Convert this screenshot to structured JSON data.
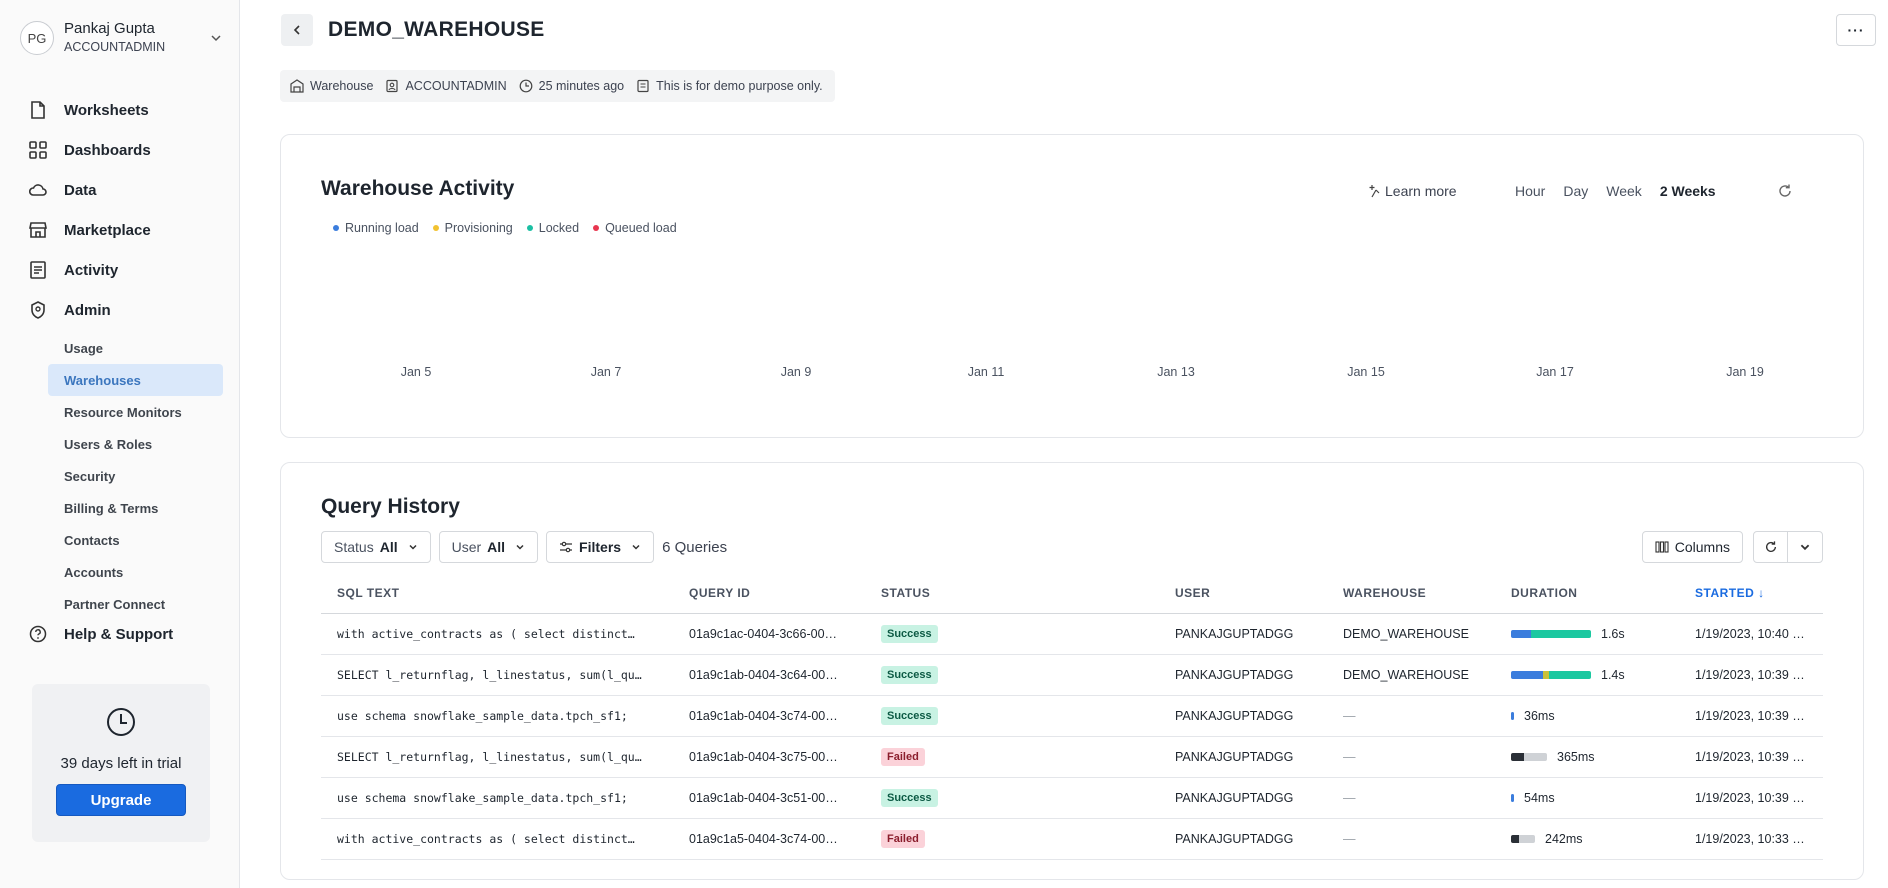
{
  "user": {
    "initials": "PG",
    "name": "Pankaj Gupta",
    "role": "ACCOUNTADMIN"
  },
  "nav": {
    "items": [
      {
        "label": "Worksheets",
        "icon": "document-icon"
      },
      {
        "label": "Dashboards",
        "icon": "grid-icon"
      },
      {
        "label": "Data",
        "icon": "cloud-icon"
      },
      {
        "label": "Marketplace",
        "icon": "store-icon"
      },
      {
        "label": "Activity",
        "icon": "list-icon"
      },
      {
        "label": "Admin",
        "icon": "shield-icon"
      }
    ],
    "admin_sub": [
      "Usage",
      "Warehouses",
      "Resource Monitors",
      "Users & Roles",
      "Security",
      "Billing & Terms",
      "Contacts",
      "Accounts",
      "Partner Connect"
    ],
    "help": "Help & Support"
  },
  "trial": {
    "text": "39 days left in trial",
    "button": "Upgrade"
  },
  "page": {
    "title": "DEMO_WAREHOUSE",
    "meta": {
      "type": "Warehouse",
      "owner": "ACCOUNTADMIN",
      "time": "25 minutes ago",
      "comment": "This is for demo purpose only."
    }
  },
  "activity": {
    "title": "Warehouse Activity",
    "learn_more": "Learn more",
    "ranges": [
      "Hour",
      "Day",
      "Week",
      "2 Weeks"
    ],
    "active_range": "2 Weeks",
    "legend": [
      {
        "label": "Running load",
        "color": "#3b7ddd"
      },
      {
        "label": "Provisioning",
        "color": "#f2c230"
      },
      {
        "label": "Locked",
        "color": "#1bbfa3"
      },
      {
        "label": "Queued load",
        "color": "#e8364f"
      }
    ],
    "ticks": [
      "Jan 5",
      "Jan 7",
      "Jan 9",
      "Jan 11",
      "Jan 13",
      "Jan 15",
      "Jan 17",
      "Jan 19"
    ]
  },
  "history": {
    "title": "Query History",
    "status_filter": {
      "label": "Status",
      "value": "All"
    },
    "user_filter": {
      "label": "User",
      "value": "All"
    },
    "filters_label": "Filters",
    "count": "6 Queries",
    "columns_label": "Columns",
    "headers": [
      "SQL TEXT",
      "QUERY ID",
      "STATUS",
      "USER",
      "WAREHOUSE",
      "DURATION",
      "STARTED"
    ],
    "rows": [
      {
        "sql": "with active_contracts as ( select distinct…",
        "qid": "01a9c1ac-0404-3c66-00…",
        "status": "Success",
        "user": "PANKAJGUPTADGG",
        "warehouse": "DEMO_WAREHOUSE",
        "duration": "1.6s",
        "duration_parts": [
          {
            "frac": 0.25,
            "color": "#3b7ddd"
          },
          {
            "frac": 0.75,
            "color": "#1bc8a0"
          }
        ],
        "started": "1/19/2023, 10:40 …"
      },
      {
        "sql": "SELECT l_returnflag, l_linestatus, sum(l_qu…",
        "qid": "01a9c1ab-0404-3c64-00…",
        "status": "Success",
        "user": "PANKAJGUPTADGG",
        "warehouse": "DEMO_WAREHOUSE",
        "duration": "1.4s",
        "duration_parts": [
          {
            "frac": 0.4,
            "color": "#3b7ddd"
          },
          {
            "frac": 0.07,
            "color": "#c9c13a"
          },
          {
            "frac": 0.53,
            "color": "#1bc8a0"
          }
        ],
        "started": "1/19/2023, 10:39 …"
      },
      {
        "sql": "use schema snowflake_sample_data.tpch_sf1;",
        "qid": "01a9c1ab-0404-3c74-00…",
        "status": "Success",
        "user": "PANKAJGUPTADGG",
        "warehouse": "—",
        "duration": "36ms",
        "duration_parts": [
          {
            "frac": 1.0,
            "color": "#3b7ddd"
          }
        ],
        "started": "1/19/2023, 10:39 …"
      },
      {
        "sql": "SELECT l_returnflag, l_linestatus, sum(l_qu…",
        "qid": "01a9c1ab-0404-3c75-00…",
        "status": "Failed",
        "user": "PANKAJGUPTADGG",
        "warehouse": "—",
        "duration": "365ms",
        "duration_parts": [
          {
            "frac": 0.35,
            "color": "#2a2f36"
          },
          {
            "frac": 0.65,
            "color": "#cfd2d6"
          }
        ],
        "started": "1/19/2023, 10:39 …"
      },
      {
        "sql": "use schema snowflake_sample_data.tpch_sf1;",
        "qid": "01a9c1ab-0404-3c51-00…",
        "status": "Success",
        "user": "PANKAJGUPTADGG",
        "warehouse": "—",
        "duration": "54ms",
        "duration_parts": [
          {
            "frac": 1.0,
            "color": "#3b7ddd"
          }
        ],
        "started": "1/19/2023, 10:39 …"
      },
      {
        "sql": "with active_contracts as ( select distinct…",
        "qid": "01a9c1a5-0404-3c74-00…",
        "status": "Failed",
        "user": "PANKAJGUPTADGG",
        "warehouse": "—",
        "duration": "242ms",
        "duration_parts": [
          {
            "frac": 0.35,
            "color": "#2a2f36"
          },
          {
            "frac": 0.65,
            "color": "#cfd2d6"
          }
        ],
        "started": "1/19/2023, 10:33 …"
      }
    ]
  }
}
